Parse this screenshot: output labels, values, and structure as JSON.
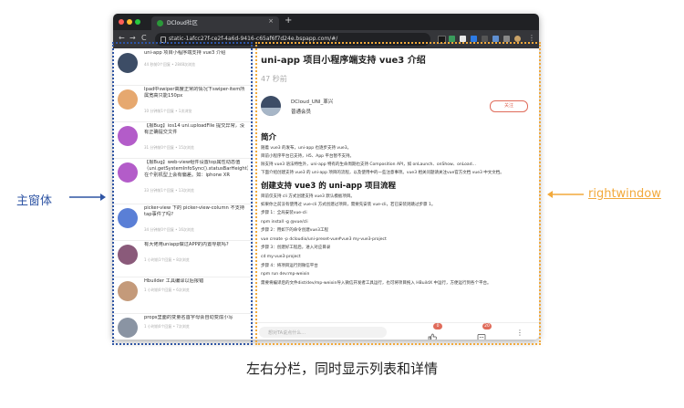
{
  "browser": {
    "tab_title": "DCloud社区",
    "tab_close": "×",
    "new_tab": "+",
    "nav_back": "←",
    "nav_forward": "→",
    "nav_reload": "C",
    "url": "static-1afcc27f-ce2f-4a6d-9416-c65af6f7d24e.bspapp.com/#/",
    "menu": "⋮"
  },
  "list": {
    "items": [
      {
        "title": "uni-app 项目小程序端支持 vue3 介绍",
        "meta": "44 秒前0个回复 • 2848次浏览"
      },
      {
        "title": "Ipad中swiper高度正常的情况下swiper-item所属宽高只能150px",
        "meta": "10 分钟前1个回复 • 1次浏览"
      },
      {
        "title": "【报Bug】ios14 uni.uploadFile 提交异常，没有正确提交文件",
        "meta": "31 分钟前0个回复 • 15次浏览"
      },
      {
        "title": "【报Bug】web-view组件设置top属性动态值（uni.getSystemInfoSync().statusBarHeight）在个别机型上会有偏差。如：iphone XR",
        "meta": "33 分钟前1个回复 • 13次浏览"
      },
      {
        "title": "picker-view 下的 picker-view-column 不支持tap事件了吗?",
        "meta": "34 分钟前0个回复 • 16次浏览"
      },
      {
        "title": "有大佬用uniapp做过APP的内置导航吗?",
        "meta": "1 小时前1个回复 • 8次浏览"
      },
      {
        "title": "Hbuilder 工具编译以后报错",
        "meta": "1 小时前0个回复 • 6次浏览"
      },
      {
        "title": "props里面的变量名首字母会自动变成小写",
        "meta": "1 小时前0个回复 • 7次浏览"
      }
    ]
  },
  "detail": {
    "title": "uni-app 项目小程序端支持 vue3 介绍",
    "time": "47 秒前",
    "author": "DCloud_UNI_革兴",
    "role": "普通会员",
    "follow_label": "关注",
    "intro_heading": "简介",
    "intro_lines": [
      "随着 vue3 的发布，uni-app 也逐步支持 vue3。",
      "目前小程序平台已支持，H5、App 平台暂不支持。",
      "除支持 vue3 语法特性外，uni-app 特有的生命周期也支持 Composition API，如 onLaunch、onShow、onLoad…",
      "下面介绍创建支持 vue3 的 uni-app 项目的流程，以及使用中的一些注意事项。vue3 相关问题请关注vue官方文档 vue3 中文文档。"
    ],
    "create_heading": "创建支持 vue3 的 uni-app 项目流程",
    "create_lines": [
      "目前仅支持 cli 方式创建支持 vue3 默认模板项目。",
      "如果你之前没有使用过 vue-cli 方式创建过项目，需要先安装 vue-cli，若已安装则跳过步骤 1。"
    ],
    "steps": [
      "步骤 1：全局安装vue-cli",
      "npm install -g @vue/cli",
      "步骤 2：用如下的命令创建vue3工程",
      "vue create -p dcloudio/uni-preset-vue#vue3 my-vue3-project",
      "步骤 3：创建好工程后，进入对应目录",
      "cd my-vue3-project",
      "步骤 4：将项目运行到微信平台",
      "npm run dev:mp-weixin",
      "需要将编译后的文件dist/dev/mp-weixin导入微信开发者工具运行，也可将项目拖入 HBuildX 中运行，方便运行到各个平台。"
    ],
    "comment_placeholder": "想对TA说点什么…",
    "like_count": "0",
    "comment_count": "20",
    "more_label": "⋮"
  },
  "annotations": {
    "left_label": "主窗体",
    "right_label": "rightwindow",
    "caption": "左右分栏，同时显示列表和详情"
  },
  "colors": {
    "left_box": "#2f55a4",
    "right_box": "#f2a93b",
    "accent": "#e06c5b"
  }
}
